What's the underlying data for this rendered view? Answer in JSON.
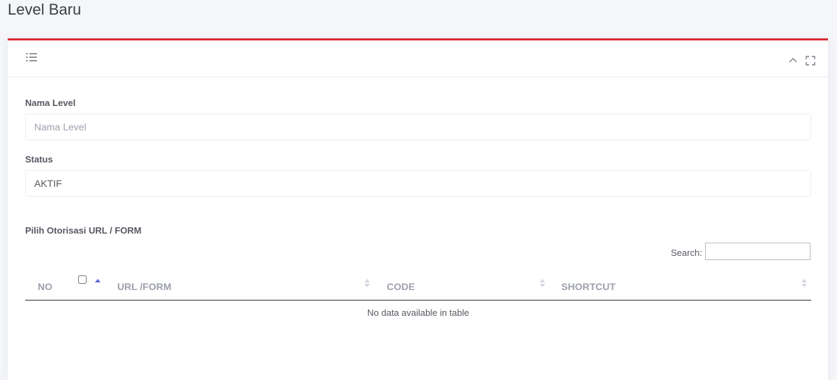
{
  "page": {
    "title": "Level Baru"
  },
  "colors": {
    "accent": "#d62d33",
    "sort_active": "#5867dd"
  },
  "portlet": {
    "head_icon": "list-icon",
    "tools": [
      "collapse-chevron-icon",
      "fullscreen-icon"
    ]
  },
  "form": {
    "nama_level": {
      "label": "Nama Level",
      "value": "",
      "placeholder": "Nama Level"
    },
    "status": {
      "label": "Status",
      "selected": "AKTIF"
    },
    "otorisasi": {
      "label": "Pilih Otorisasi URL / FORM"
    }
  },
  "table": {
    "search_label": "Search:",
    "search_value": "",
    "columns": [
      "NO",
      "URL /FORM",
      "CODE",
      "SHORTCUT"
    ],
    "rows": [],
    "empty_message": "No data available in table"
  }
}
